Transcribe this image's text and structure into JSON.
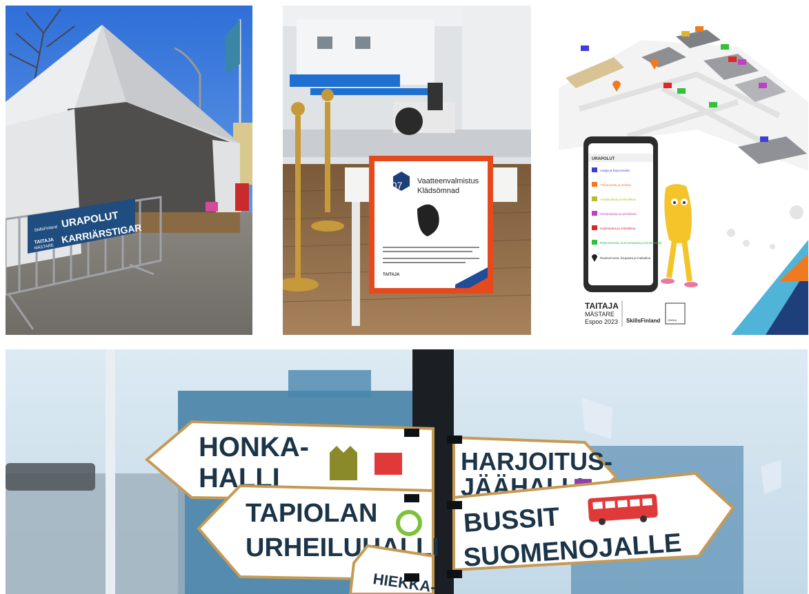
{
  "photo1": {
    "banner_line1": "URAPOLUT",
    "banner_line2": "KARRIÄRSTIGAR",
    "logo_skills": "SkillsFinland",
    "logo_taitaja": "TAITAJA",
    "logo_mastare": "MÄSTARE"
  },
  "photo2": {
    "station_number": "307",
    "title_line1": "Vaatteenvalmistus",
    "title_line2": "Klädsömnad",
    "logo_taitaja": "TAITAJA"
  },
  "photo3": {
    "phone_title": "URAPOLUT",
    "legend": [
      {
        "text": "Autoja ja koja koneita",
        "color": "#3b3fd4"
      },
      {
        "text": "Tietokoneita ja medias",
        "color": "#f07a20"
      },
      {
        "text": "Asiakkuuksia ja tekniikkaa",
        "color": "#b6bc2a"
      },
      {
        "text": "Käsityötaitoja ja tekniikkaa",
        "color": "#c23fc5"
      },
      {
        "text": "Huolenpitoa ja estetiikkaa",
        "color": "#e0262a"
      },
      {
        "text": "Rakentamista, kunnossapitoa ja kiinteistöistä",
        "color": "#34c03a"
      }
    ],
    "pin_item": "Ravitsemusta, kaupasta ja matkailua",
    "brand_taitaja": "TAITAJA",
    "brand_mastare": "MÄSTARE",
    "brand_place": "Espoo 2023",
    "brand_skills": "SkillsFinland",
    "brand_omnia": "OMNIA"
  },
  "photo4": {
    "sign_honka_1": "HONKA-",
    "sign_honka_2": "HALLI",
    "sign_harjoitus_1": "HARJOITUS-",
    "sign_harjoitus_2": "JÄÄHALLI",
    "sign_tapiolan_1": "TAPIOLAN",
    "sign_tapiolan_2": "URHEILUHALLI",
    "sign_bussit_1": "BUSSIT",
    "sign_bussit_2": "SUOMENOJALLE",
    "sign_hiekka": "HIEKKA-"
  }
}
